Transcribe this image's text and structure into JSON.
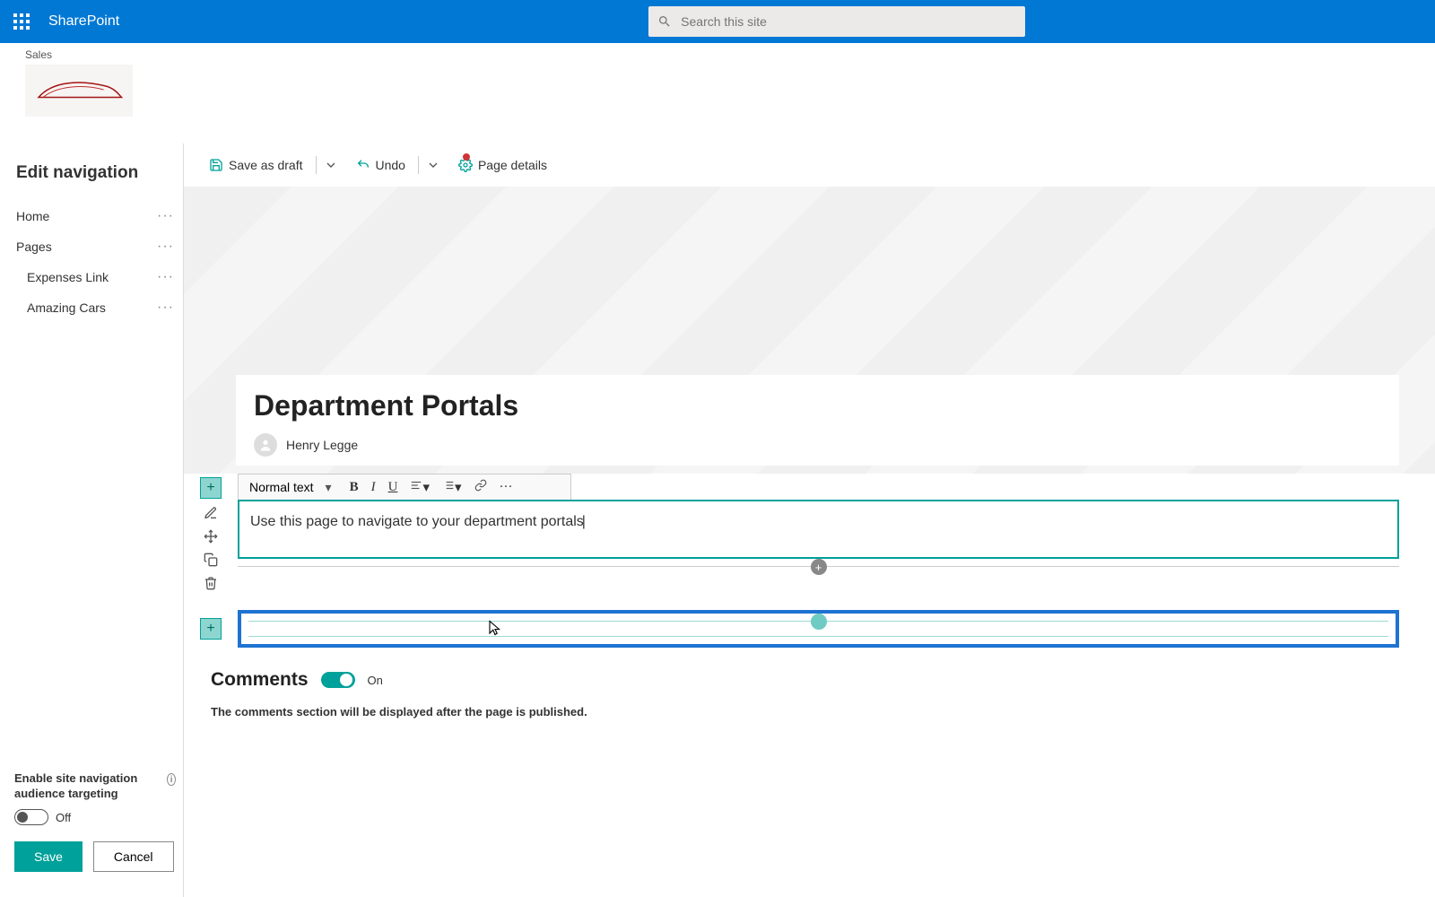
{
  "suite": {
    "app_name": "SharePoint",
    "search_placeholder": "Search this site"
  },
  "site": {
    "name": "Sales"
  },
  "sidebar": {
    "title": "Edit navigation",
    "items": [
      {
        "label": "Home",
        "child": false
      },
      {
        "label": "Pages",
        "child": false
      },
      {
        "label": "Expenses Link",
        "child": true
      },
      {
        "label": "Amazing Cars",
        "child": true
      }
    ],
    "audience_targeting_label": "Enable site navigation audience targeting",
    "audience_targeting_state": "Off",
    "save_label": "Save",
    "cancel_label": "Cancel"
  },
  "command_bar": {
    "save_draft": "Save as draft",
    "undo": "Undo",
    "page_details": "Page details"
  },
  "page": {
    "title": "Department Portals",
    "author": "Henry Legge"
  },
  "rte": {
    "style": "Normal text",
    "content": "Use this page to navigate to your department portals"
  },
  "comments": {
    "title": "Comments",
    "state": "On",
    "note": "The comments section will be displayed after the page is published."
  }
}
